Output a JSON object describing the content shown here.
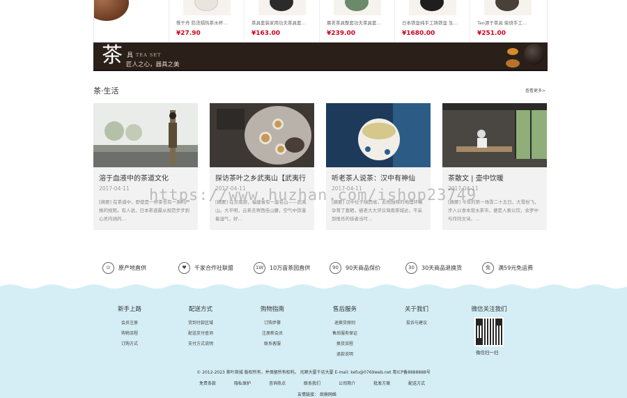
{
  "products": [
    {
      "name": "餐干舟 防烫隔热茶水杯…",
      "price": "¥27.90"
    },
    {
      "name": "茶具套装家用功夫茶具套…",
      "price": "¥163.00"
    },
    {
      "name": "晨茗茶具整套功夫茶具套…",
      "price": "¥239.00"
    },
    {
      "name": "日本铁壶纯手工铸铁壶 生…",
      "price": "¥1680.00"
    },
    {
      "name": "Tao源于茶具 柴烧手工…",
      "price": "¥251.00"
    }
  ],
  "banner": {
    "char": "茶",
    "ju": "具",
    "en": "TEA SET",
    "slogan": "匠人之心，器具之美"
  },
  "section": {
    "title": "茶·生活",
    "more": "查看更多>"
  },
  "articles": [
    {
      "title": "溶于血液中的茶道文化",
      "date": "2017-04-11",
      "excerpt": "[摘要] 在茶道中，即使是一杯茶也有一系列严格的规矩。有人说，日本茶道最从规范步步到心灵内涵的…"
    },
    {
      "title": "探访茶叶之乡武夷山【武夷行",
      "date": "2017-04-11",
      "excerpt": "[摘要] 在东南部，福建省有一座名山——武夷山。大平明，云来去寄西佳山腰，空气中弥漫着湿气，好…"
    },
    {
      "title": "听老茶人说茶：汉中有神仙",
      "date": "2017-04-11",
      "excerpt": "[摘要] 汉中位于陕西省，此地独特的地理环境孕育了富硒，被老大大评议海南茶城达，不采到惟肖的佳者当可…"
    },
    {
      "title": "茶散文 | 壶中饮暖",
      "date": "2017-04-11",
      "excerpt": "[摘要] 今年的第一场雪二十五日，大雪纷飞，步入以食本营水茶市，便是人索以饮，余罗中与作同文诗，…"
    }
  ],
  "guarantees": [
    {
      "icon": "location-icon",
      "glyph": "⊙",
      "text": "原产地直供"
    },
    {
      "icon": "handshake-icon",
      "glyph": "♥",
      "text": "千家合作社联盟"
    },
    {
      "icon": "garden-icon",
      "glyph": "1W",
      "text": "10万亩茶园直供"
    },
    {
      "icon": "price-protect-icon",
      "glyph": "90",
      "text": "90天商品保价"
    },
    {
      "icon": "return-icon",
      "glyph": "30",
      "text": "30天商品退换货"
    },
    {
      "icon": "free-shipping-icon",
      "glyph": "免",
      "text": "满59元免运费"
    }
  ],
  "footer": {
    "columns": [
      {
        "head": "新手上路",
        "links": [
          "会员注册",
          "购物流程",
          "订购方式"
        ]
      },
      {
        "head": "配送方式",
        "links": [
          "货到付款区域",
          "配送支付查询",
          "支付方式说明"
        ]
      },
      {
        "head": "购物指南",
        "links": [
          "订购步骤",
          "注册新会员",
          "联系客服"
        ]
      },
      {
        "head": "售后服务",
        "links": [
          "退换货原则",
          "售后服务保证",
          "换货流程",
          "退款说明"
        ]
      },
      {
        "head": "关于我们",
        "links": [
          "投诉与建议"
        ]
      },
      {
        "head": "微信关注我们",
        "links": []
      }
    ],
    "qr_caption": "微信扫一扫",
    "copyright": "© 2012-2023 茶叶商城 版权所有，并保留所有权利。 兆顺大厦千坊大厦 E-mail: kefu@0769web.net 粤ICP备8888888号",
    "links": [
      "免责条款",
      "隐私保护",
      "咨询热点",
      "联系我们",
      "公司简介",
      "批发方案",
      "配送方式"
    ],
    "friend": "友情链接： 商鼎网络"
  },
  "watermark": "https://www.huzhan.com/ishop23749"
}
